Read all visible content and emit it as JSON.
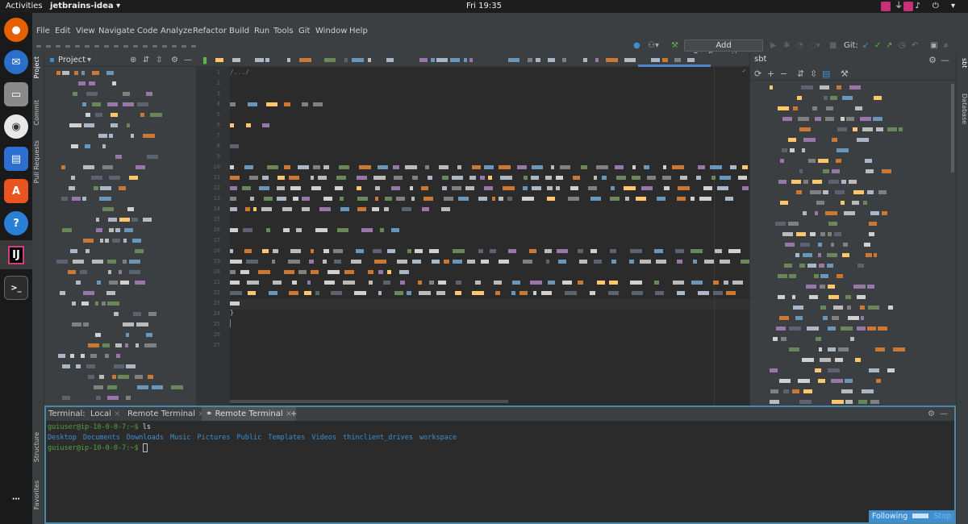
{
  "topbar": {
    "activities": "Activities",
    "app_name": "jetbrains-idea",
    "clock": "Fri 19:35"
  },
  "menu": [
    "File",
    "Edit",
    "View",
    "Navigate",
    "Code",
    "Analyze",
    "Refactor",
    "Build",
    "Run",
    "Tools",
    "Git",
    "Window",
    "Help"
  ],
  "toolbar": {
    "add_configuration": "Add Configuration...",
    "git_label": "Git:"
  },
  "left_strip": {
    "project": "Project",
    "commit": "Commit",
    "pull_requests": "Pull Requests",
    "structure": "Structure",
    "favorites": "Favorites"
  },
  "project_panel": {
    "title": "Project"
  },
  "editor": {
    "first_line": "/.../",
    "closing_brace": "}",
    "line_numbers": [
      "1",
      "2",
      "3",
      "4",
      "5",
      "6",
      "7",
      "8",
      "9",
      "10",
      "11",
      "12",
      "13",
      "14",
      "15",
      "16",
      "17",
      "18",
      "19",
      "20",
      "21",
      "22",
      "23",
      "24",
      "25",
      "26",
      "27"
    ]
  },
  "sbt_panel": {
    "title": "sbt"
  },
  "right_strip": {
    "sbt": "sbt",
    "database": "Database"
  },
  "terminal": {
    "label": "Terminal:",
    "tabs": [
      "Local",
      "Remote Terminal",
      "Remote Terminal"
    ],
    "prompt1": "guiuser@ip-10-0-0-7:~$",
    "cmd1": " ls",
    "dirs": [
      "Desktop",
      "Documents",
      "Downloads",
      "Music",
      "Pictures",
      "Public",
      "Templates",
      "Videos",
      "thinclient_drives",
      "workspace"
    ],
    "prompt2": "guiuser@ip-10-0-0-7:~$",
    "following": "Following",
    "stop": "Stop"
  }
}
